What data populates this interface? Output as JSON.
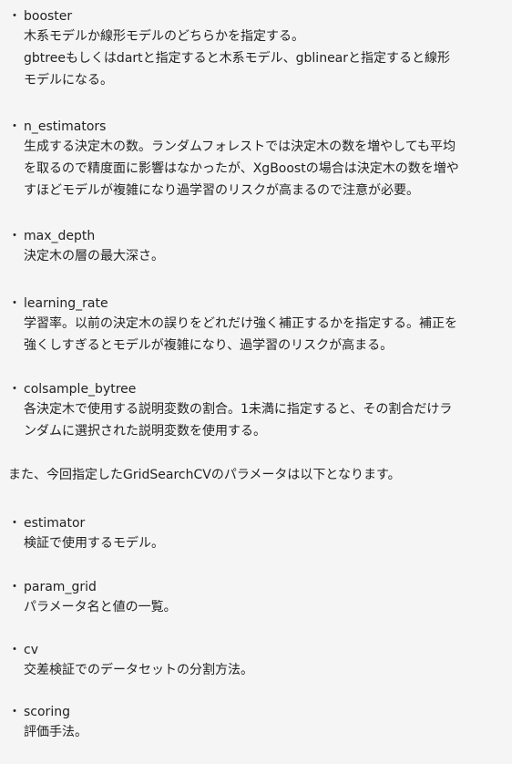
{
  "bullet_glyph": "・",
  "params1": [
    {
      "term": "booster",
      "desc": [
        "木系モデルか線形モデルのどちらかを指定する。",
        "gbtreeもしくはdartと指定すると木系モデル、gblinearと指定すると線形",
        "モデルになる。"
      ]
    },
    {
      "term": "n_estimators",
      "desc": [
        "生成する決定木の数。ランダムフォレストでは決定木の数を増やしても平均",
        "を取るので精度面に影響はなかったが、XgBoostの場合は決定木の数を増や",
        "すほどモデルが複雑になり過学習のリスクが高まるので注意が必要。"
      ]
    },
    {
      "term": "max_depth",
      "desc": [
        "決定木の層の最大深さ。"
      ]
    },
    {
      "term": "learning_rate",
      "desc": [
        "学習率。以前の決定木の誤りをどれだけ強く補正するかを指定する。補正を",
        "強くしすぎるとモデルが複雑になり、過学習のリスクが高まる。"
      ]
    },
    {
      "term": "colsample_bytree",
      "desc": [
        "各決定木で使用する説明変数の割合。1未満に指定すると、その割合だけラ",
        "ンダムに選択された説明変数を使用する。"
      ]
    }
  ],
  "intro": "また、今回指定したGridSearchCVのパラメータは以下となります。",
  "params2": [
    {
      "term": "estimator",
      "desc": [
        "検証で使用するモデル。"
      ]
    },
    {
      "term": "param_grid",
      "desc": [
        "パラメータ名と値の一覧。"
      ]
    },
    {
      "term": "cv",
      "desc": [
        "交差検証でのデータセットの分割方法。"
      ]
    },
    {
      "term": "scoring",
      "desc": [
        "評価手法。"
      ]
    }
  ]
}
